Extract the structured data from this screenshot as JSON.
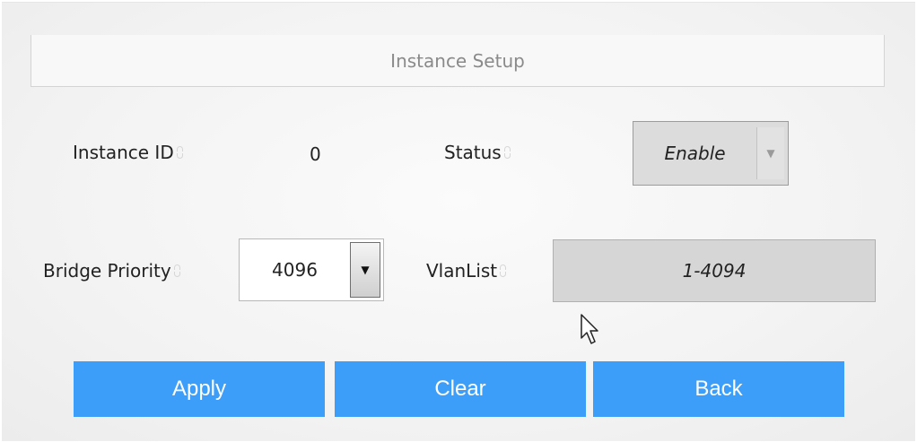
{
  "header": {
    "title": "Instance Setup"
  },
  "form": {
    "instance_id_label": "Instance ID",
    "instance_id_value": "0",
    "status_label": "Status",
    "status_value": "Enable",
    "bridge_priority_label": "Bridge Priority",
    "bridge_priority_value": "4096",
    "vlanlist_label": "VlanList",
    "vlanlist_value": "1-4094"
  },
  "buttons": {
    "apply": "Apply",
    "clear": "Clear",
    "back": "Back"
  },
  "colors": {
    "button_bg": "#3d9ef9",
    "button_text": "#ffffff"
  },
  "icons": {
    "dropdown": "chevron-down-icon",
    "pointer": "mouse-pointer-icon"
  }
}
